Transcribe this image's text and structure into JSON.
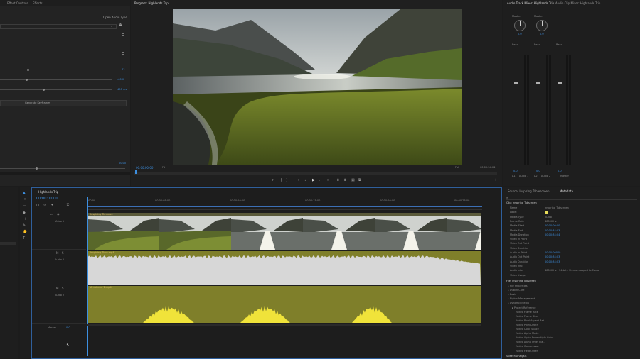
{
  "effect_controls": {
    "tabs": [
      "Effect Controls",
      "Effects"
    ],
    "button": "Open Audio Type",
    "values": [
      "43",
      "-60.0",
      "400 ms"
    ],
    "generate_label": "Generate Keyframes",
    "bottom_time": "00:00"
  },
  "program": {
    "title": "Program: Highlands Trip",
    "timecode": "00:00:00:00",
    "fit": "Fit",
    "full": "Full",
    "duration": "00:00:34:04"
  },
  "mixer": {
    "tabs": [
      "Audio Track Mixer: Highlands Trip",
      "Audio Clip Mixer: Highlands Trip"
    ],
    "routing": [
      "Master",
      "Master"
    ],
    "read": [
      "Read",
      "Read",
      "Read"
    ],
    "knob_values": [
      "0.0",
      "0.0"
    ],
    "channels": [
      "A1",
      "Audio 1",
      "A2",
      "Audio 2",
      "Master"
    ],
    "levels": [
      "0.0",
      "0.0",
      "0.0"
    ]
  },
  "timeline": {
    "tab": "Highlands Trip",
    "timecode": "00:00:00:00",
    "ruler": [
      ":00:00",
      "00:00:05:00",
      "00:00:10:00",
      "00:00:15:00",
      "00:00:20:00",
      "00:00:25:00",
      "00:00:30:00"
    ],
    "tracks": [
      "Video 1",
      "Audio 1",
      "Audio 2"
    ],
    "clips": [
      "Inspiring Tim.mp4",
      "Inspiring Ticur.mp4",
      "Ambience 1.mp4"
    ],
    "master": "Master",
    "master_val": "0.0"
  },
  "metadata": {
    "tabs": [
      "Source: Inspiring Tablescreen",
      "Metadata"
    ],
    "clip_header": "Clip: Inspiring Tabscreen",
    "rows": [
      {
        "k": "Name",
        "v": "Inspiring Tabscreen"
      },
      {
        "k": "Label",
        "v": ""
      },
      {
        "k": "Media Type",
        "v": "Audio"
      },
      {
        "k": "Frame Rate",
        "v": "48000 Hz"
      },
      {
        "k": "Media Start",
        "v": "00:00:00:00"
      },
      {
        "k": "Media End",
        "v": "00:00:34:03"
      },
      {
        "k": "Media Duration",
        "v": "00:00:34:04"
      },
      {
        "k": "Video In Point",
        "v": ""
      },
      {
        "k": "Video Out Point",
        "v": ""
      },
      {
        "k": "Video Duration",
        "v": ""
      },
      {
        "k": "Audio In Point",
        "v": "00:00:00000"
      },
      {
        "k": "Audio Out Point",
        "v": "00:00:34:03"
      },
      {
        "k": "Audio Duration",
        "v": "00:00:34:03"
      },
      {
        "k": "Video Info",
        "v": ""
      },
      {
        "k": "Audio Info",
        "v": "48000 Hz - 24-bit - Stereo mapped to Mono"
      },
      {
        "k": "Video Usage",
        "v": ""
      }
    ],
    "file_header": "File: Inspiring Tabscreen",
    "tree": [
      "File Properties",
      "Dublin Core",
      "Basic",
      "Rights Management",
      "Dynamic Media",
      "Project Reference",
      "Video Frame Rate",
      "Video Frame Size",
      "Video Pixel Aspect Rat...",
      "Video Pixel Depth",
      "Video Color Space",
      "Video Alpha Mode",
      "Video Alpha Premultiple Color",
      "Video Alpha Unity Fla...",
      "Video Compressor",
      "Video Field Order"
    ],
    "speech": "Speech Analysis"
  }
}
